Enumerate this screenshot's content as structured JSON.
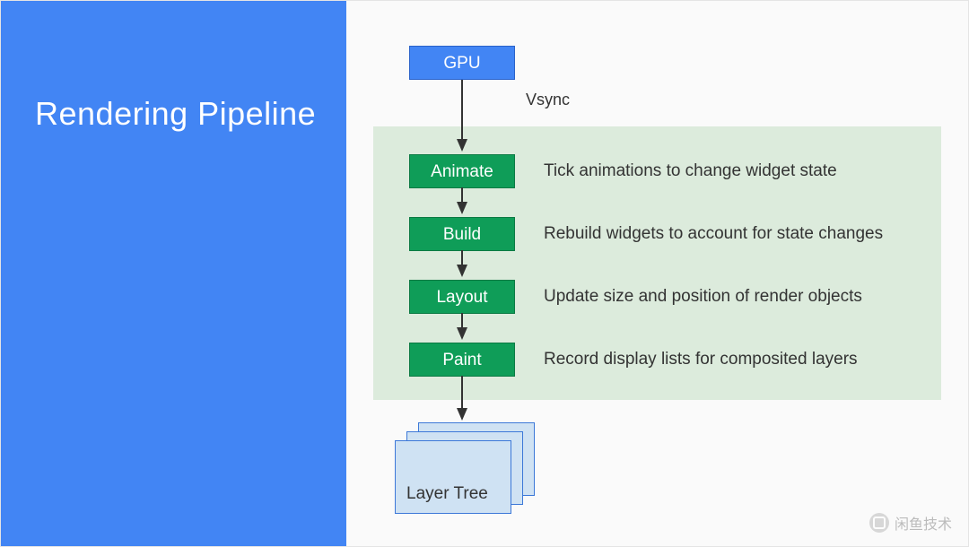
{
  "title": "Rendering Pipeline",
  "gpu": {
    "label": "GPU"
  },
  "vsync": {
    "label": "Vsync"
  },
  "stages": [
    {
      "name": "Animate",
      "desc": "Tick animations to change widget state"
    },
    {
      "name": "Build",
      "desc": "Rebuild widgets to account for state changes"
    },
    {
      "name": "Layout",
      "desc": "Update size and position of render objects"
    },
    {
      "name": "Paint",
      "desc": "Record display lists for composited layers"
    }
  ],
  "layer_tree": {
    "label": "Layer Tree"
  },
  "watermark": {
    "text": "闲鱼技术"
  }
}
